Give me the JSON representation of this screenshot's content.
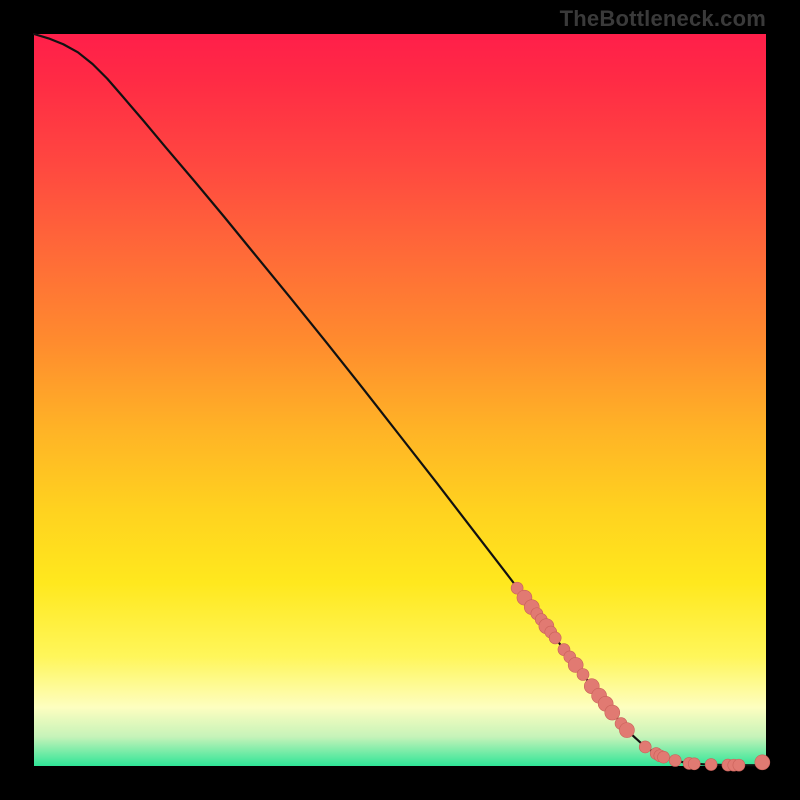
{
  "watermark": "TheBottleneck.com",
  "colors": {
    "curve_stroke": "#111111",
    "point_fill": "#e17a72",
    "point_stroke": "#c96059"
  },
  "chart_data": {
    "type": "line",
    "title": "",
    "xlabel": "",
    "ylabel": "",
    "xlim": [
      0,
      100
    ],
    "ylim": [
      0,
      100
    ],
    "grid": false,
    "legend": false,
    "series": [
      {
        "name": "curve",
        "x": [
          0,
          2,
          4,
          6,
          8,
          10,
          12,
          15,
          18,
          22,
          26,
          30,
          35,
          40,
          45,
          50,
          55,
          60,
          65,
          70,
          74,
          78,
          81,
          83.5,
          85.5,
          87.5,
          89,
          90.5,
          92,
          93.5,
          95,
          97,
          99,
          100
        ],
        "y": [
          100,
          99.4,
          98.6,
          97.5,
          95.9,
          93.9,
          91.6,
          88.1,
          84.5,
          79.8,
          75.0,
          70.1,
          64.0,
          57.8,
          51.5,
          45.1,
          38.7,
          32.2,
          25.7,
          19.1,
          13.8,
          8.6,
          4.9,
          2.6,
          1.4,
          0.75,
          0.45,
          0.3,
          0.2,
          0.15,
          0.12,
          0.11,
          0.1,
          0.1
        ]
      }
    ],
    "points": {
      "name": "highlighted-points",
      "x": [
        66,
        67,
        68,
        68.7,
        69.3,
        70,
        70.6,
        71.2,
        72.4,
        73.2,
        74,
        75,
        76.2,
        77.2,
        78.1,
        79,
        80.2,
        81,
        83.5,
        85,
        85.5,
        86,
        87.6,
        89.5,
        90.2,
        92.5,
        94.8,
        95.6,
        96.3,
        99.5
      ],
      "y": [
        24.3,
        23.0,
        21.7,
        20.8,
        20.0,
        19.1,
        18.3,
        17.5,
        15.9,
        14.9,
        13.8,
        12.5,
        10.9,
        9.6,
        8.5,
        7.3,
        5.8,
        4.9,
        2.6,
        1.7,
        1.4,
        1.2,
        0.75,
        0.35,
        0.3,
        0.2,
        0.13,
        0.12,
        0.12,
        0.5
      ],
      "r": [
        6,
        7.5,
        7.5,
        6,
        6,
        7.5,
        6,
        6,
        6,
        6,
        7.5,
        6,
        7.5,
        7.5,
        7.5,
        7.5,
        6,
        7.5,
        6,
        6,
        6,
        6,
        6,
        6,
        6,
        6,
        6,
        6,
        6,
        7.5
      ]
    }
  }
}
